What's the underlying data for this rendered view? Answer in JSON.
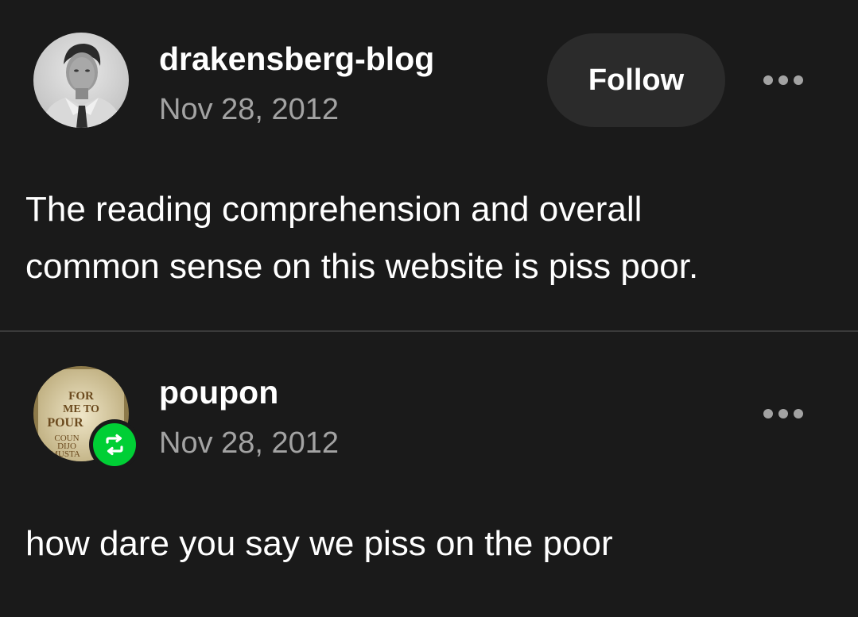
{
  "posts": [
    {
      "username": "drakensberg-blog",
      "date": "Nov 28, 2012",
      "follow_label": "Follow",
      "body_lines": [
        "The reading comprehension and overall",
        "common sense on this website is piss poor."
      ],
      "avatar": "portrait-avatar",
      "more_icon": "ellipsis-icon"
    },
    {
      "username": "poupon",
      "date": "Nov 28, 2012",
      "body_lines": [
        "how dare you say we piss on the poor"
      ],
      "avatar": "mustard-jar-avatar",
      "badge_icon": "reblog-icon",
      "more_icon": "ellipsis-icon",
      "avatar_label_lines": [
        "FOR",
        "ME TO",
        "POUR",
        "COUN",
        "DIJO",
        "MUSTA"
      ]
    }
  ],
  "colors": {
    "background": "#1a1a1a",
    "text_primary": "#ffffff",
    "text_secondary": "#a3a3a3",
    "button_bg": "#2b2b2b",
    "reblog_green": "#00cf35",
    "divider": "#3a3a3a"
  }
}
